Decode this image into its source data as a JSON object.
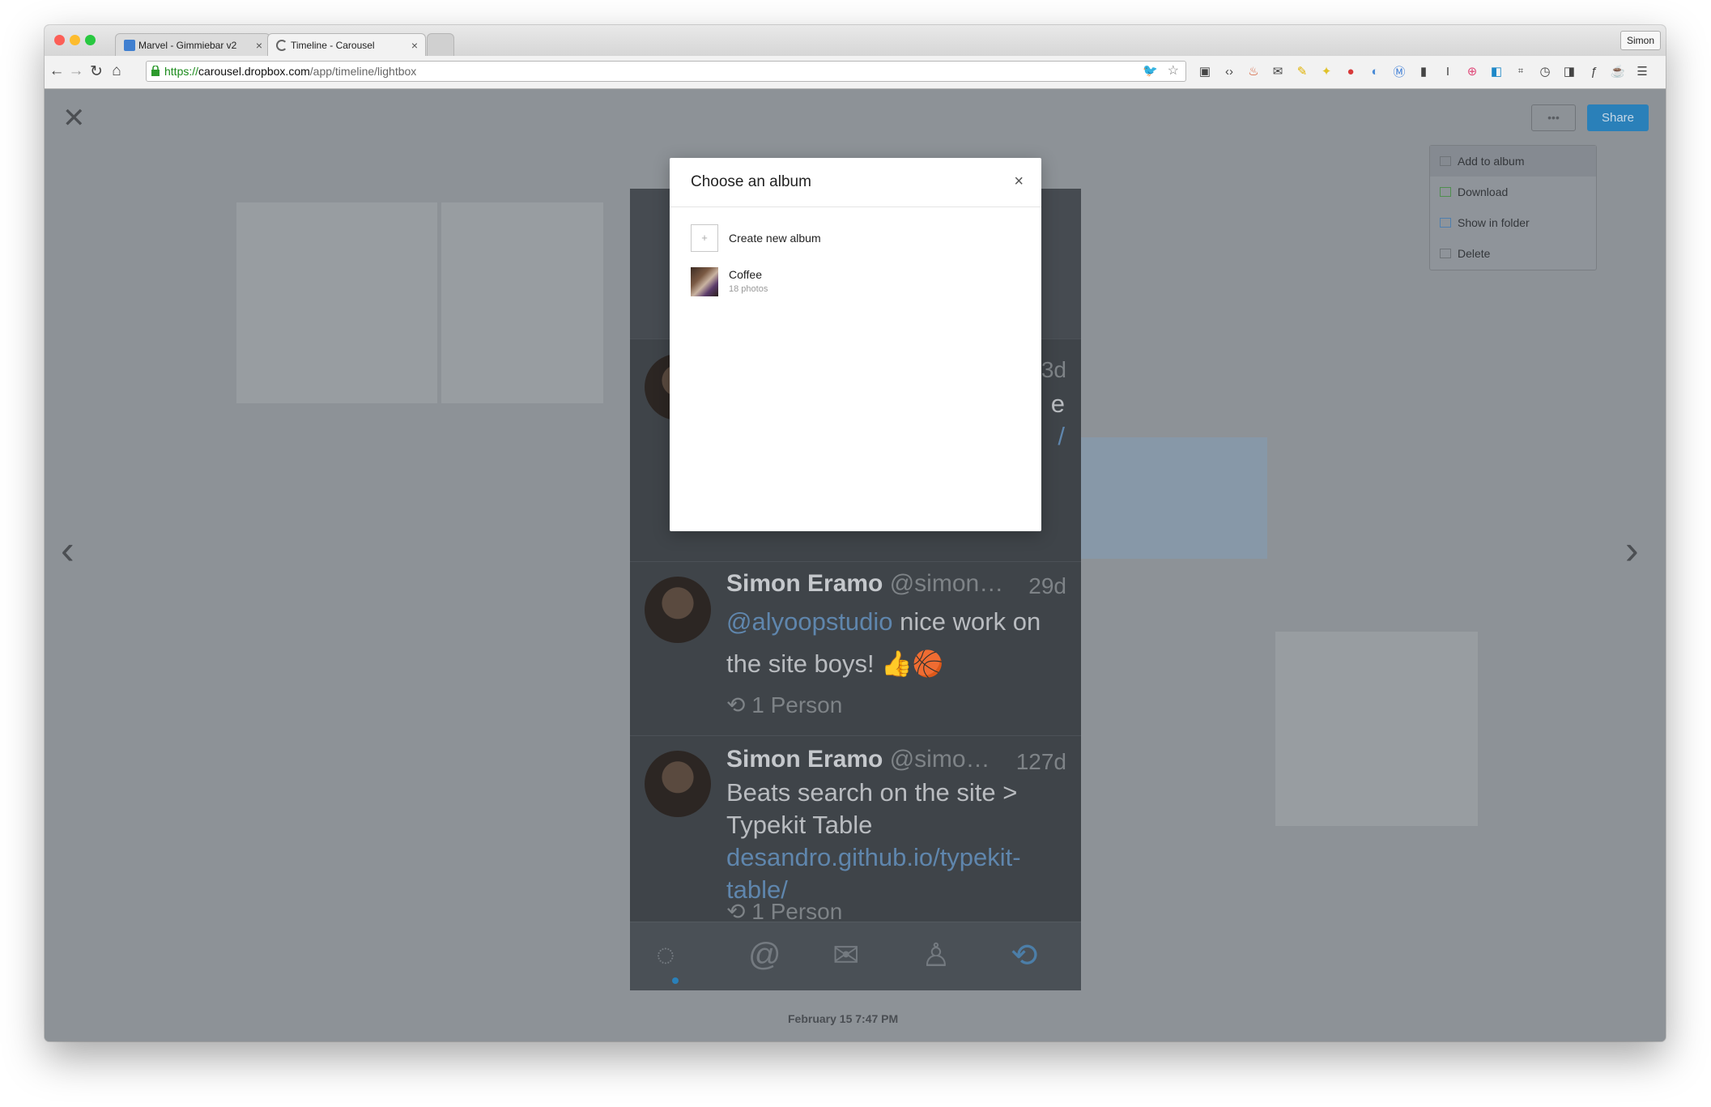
{
  "browser": {
    "tabs": [
      {
        "title": "Marvel - Gimmiebar v2"
      },
      {
        "title": "Timeline - Carousel"
      }
    ],
    "user_button": "Simon",
    "url": {
      "proto": "https://",
      "host": "carousel.dropbox.com",
      "path": "/app/timeline/lightbox"
    }
  },
  "lightbox": {
    "share_label": "Share",
    "more_label": "•••",
    "timestamp": "February 15 7:47 PM",
    "menu": [
      {
        "label": "Add to album",
        "icon": "album-icon"
      },
      {
        "label": "Download",
        "icon": "download-icon"
      },
      {
        "label": "Show in folder",
        "icon": "folder-icon"
      },
      {
        "label": "Delete",
        "icon": "trash-icon"
      }
    ]
  },
  "phone": {
    "tweets": [
      {
        "name": "Simon Eramo",
        "handle": "@simon…",
        "age": "29d",
        "mention": "@alyoopstudio",
        "text": " nice work on the site boys! 👍🏀",
        "retweet": "1 Person"
      },
      {
        "name": "Simon Eramo",
        "handle": "@simo…",
        "age": "127d",
        "text": "Beats search on the site > Typekit Table",
        "link": "desandro.github.io/typekit-table/",
        "retweet": "1 Person"
      }
    ],
    "partial": {
      "age": "3d",
      "text_a": "e",
      "text_b": "/"
    }
  },
  "modal": {
    "title": "Choose an album",
    "close": "×",
    "create_label": "Create new album",
    "albums": [
      {
        "name": "Coffee",
        "count": "18 photos"
      }
    ]
  }
}
